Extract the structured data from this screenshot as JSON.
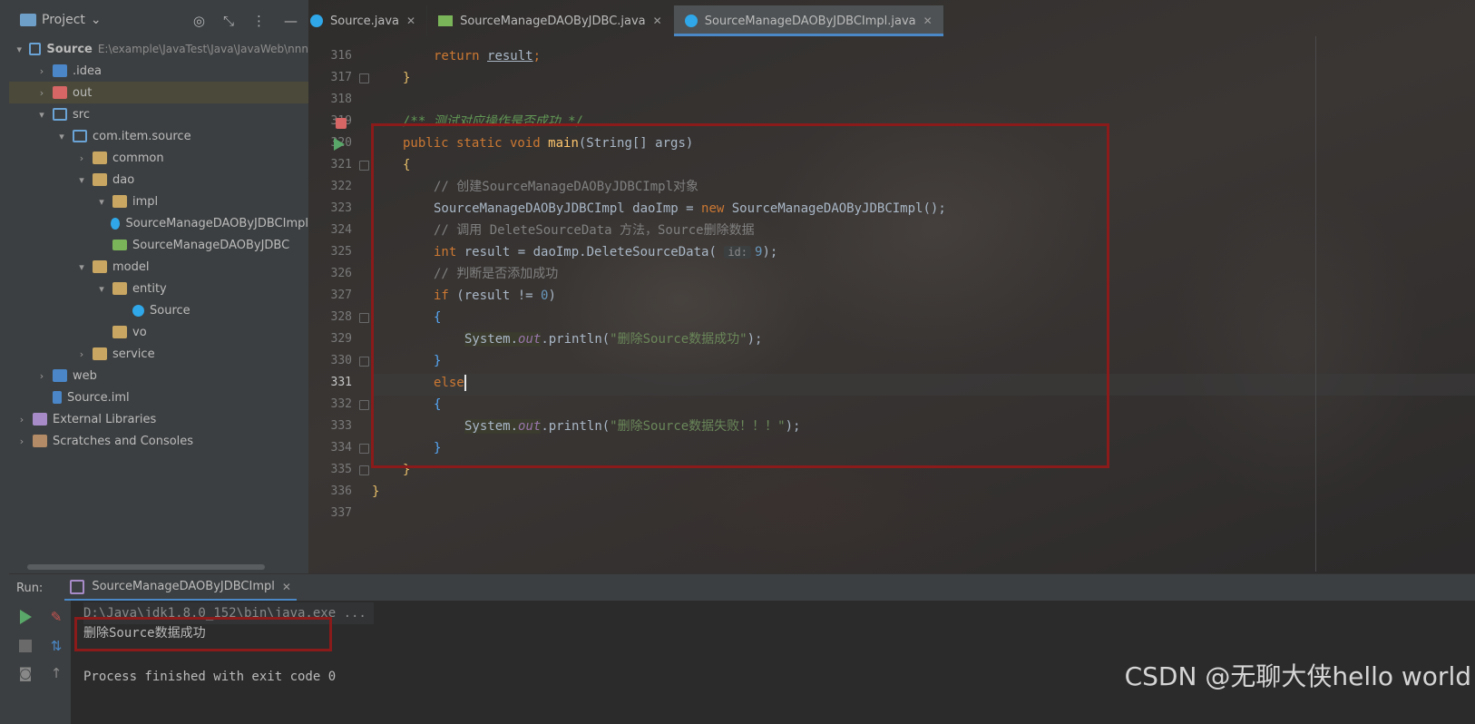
{
  "project_panel": {
    "title": "Project",
    "header_icons": [
      "target-icon",
      "collapse-icon",
      "more-icon",
      "minimize-icon"
    ],
    "tree": [
      {
        "label": "Source",
        "path": "E:\\example\\JavaTest\\Java\\JavaWeb\\nnn",
        "indent": 0,
        "toggle": "▾",
        "icon": "module-icon",
        "bold": true
      },
      {
        "label": ".idea",
        "indent": 1,
        "toggle": "›",
        "icon": "folder-icon"
      },
      {
        "label": "out",
        "indent": 1,
        "toggle": "›",
        "icon": "folder-excluded-icon",
        "selected": true
      },
      {
        "label": "src",
        "indent": 1,
        "toggle": "▾",
        "icon": "source-folder-icon"
      },
      {
        "label": "com.item.source",
        "indent": 2,
        "toggle": "▾",
        "icon": "package-icon"
      },
      {
        "label": "common",
        "indent": 3,
        "toggle": "›",
        "icon": "package-folder-icon"
      },
      {
        "label": "dao",
        "indent": 3,
        "toggle": "▾",
        "icon": "package-folder-icon"
      },
      {
        "label": "impl",
        "indent": 4,
        "toggle": "▾",
        "icon": "package-folder-icon"
      },
      {
        "label": "SourceManageDAOByJDBCImpl",
        "indent": 5,
        "toggle": "",
        "icon": "class-icon"
      },
      {
        "label": "SourceManageDAOByJDBC",
        "indent": 4,
        "toggle": "",
        "icon": "interface-icon"
      },
      {
        "label": "model",
        "indent": 3,
        "toggle": "▾",
        "icon": "package-folder-icon"
      },
      {
        "label": "entity",
        "indent": 4,
        "toggle": "▾",
        "icon": "package-folder-icon"
      },
      {
        "label": "Source",
        "indent": 5,
        "toggle": "",
        "icon": "class-icon"
      },
      {
        "label": "vo",
        "indent": 4,
        "toggle": "",
        "icon": "package-folder-icon"
      },
      {
        "label": "service",
        "indent": 3,
        "toggle": "›",
        "icon": "package-folder-icon"
      },
      {
        "label": "web",
        "indent": 1,
        "toggle": "›",
        "icon": "web-folder-icon"
      },
      {
        "label": "Source.iml",
        "indent": 1,
        "toggle": "",
        "icon": "iml-file-icon"
      },
      {
        "label": "External Libraries",
        "indent": 0,
        "toggle": "›",
        "icon": "libraries-icon"
      },
      {
        "label": "Scratches and Consoles",
        "indent": 0,
        "toggle": "›",
        "icon": "scratches-icon"
      }
    ]
  },
  "editor_tabs": [
    {
      "label": "Source.java",
      "icon": "class-icon",
      "active": false
    },
    {
      "label": "SourceManageDAOByJDBC.java",
      "icon": "interface-icon",
      "active": false
    },
    {
      "label": "SourceManageDAOByJDBCImpl.java",
      "icon": "class-icon",
      "active": true
    }
  ],
  "tab_close_glyph": "✕",
  "line_numbers": [
    "316",
    "317",
    "318",
    "319",
    "320",
    "321",
    "322",
    "323",
    "324",
    "325",
    "326",
    "327",
    "328",
    "329",
    "330",
    "331",
    "332",
    "333",
    "334",
    "335",
    "336",
    "337"
  ],
  "current_line": "331",
  "code": {
    "l316": {
      "kw": "return",
      "id": "result",
      "end": ";"
    },
    "l317": "}",
    "l319": "/** 测试对应操作是否成功 */",
    "l320": {
      "mod": "public static void",
      "fn": "main",
      "params": "(String[] args)"
    },
    "l321": "{",
    "l322": "// 创建SourceManageDAOByJDBCImpl对象",
    "l323": {
      "pre": "SourceManageDAOByJDBCImpl daoImp = ",
      "kw": "new",
      "post": " SourceManageDAOByJDBCImpl();"
    },
    "l324": "// 调用 DeleteSourceData 方法，Source删除数据",
    "l325": {
      "kw": "int",
      "pre": " result = daoImp.DeleteSourceData( ",
      "hint": "id:",
      "num": "9",
      "post": ");"
    },
    "l326": "// 判断是否添加成功",
    "l327": {
      "kw": "if",
      "pre": " (result != ",
      "num": "0",
      "post": ")"
    },
    "l328": "{",
    "l329": {
      "sys": "System.",
      "out": "out",
      "mid": ".println(",
      "str": "\"删除Source数据成功\"",
      "end": ");"
    },
    "l330": "}",
    "l331": "else",
    "l332": "{",
    "l333": {
      "sys": "System.",
      "out": "out",
      "mid": ".println(",
      "str": "\"删除Source数据失败！！！\"",
      "end": ");"
    },
    "l334": "}",
    "l335": "}",
    "l336": "}"
  },
  "run_panel": {
    "label": "Run:",
    "tab": "SourceManageDAOByJDBCImpl",
    "console": {
      "command": "D:\\Java\\jdk1.8.0_152\\bin\\java.exe ...",
      "output": "删除Source数据成功",
      "exit": "Process finished with exit code 0"
    }
  },
  "watermark": "CSDN @无聊大侠hello world",
  "colors": {
    "keyword": "#cc7832",
    "function": "#ffc66d",
    "string": "#6a8759",
    "number": "#6897bb",
    "comment": "#808080",
    "highlight_box": "#8b1a1a"
  }
}
